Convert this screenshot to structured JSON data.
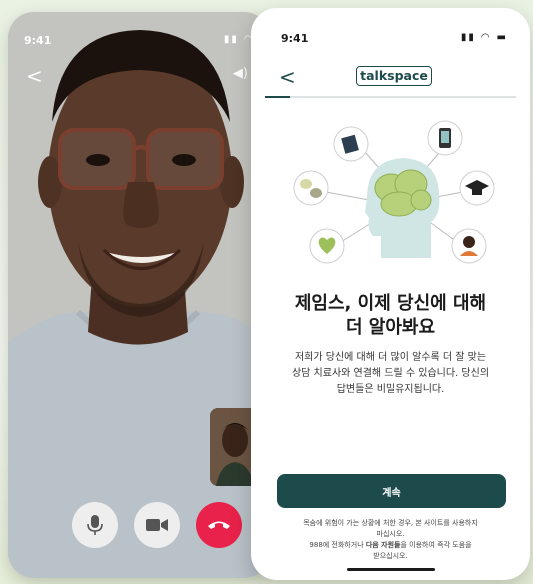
{
  "left_phone": {
    "time": "9:41",
    "status_icons": "▮▮ ◠",
    "back_glyph": "<",
    "speaker_glyph": "◀)",
    "controls": {
      "mic_icon": "microphone-icon",
      "camera_icon": "video-camera-icon",
      "end_icon": "end-call-icon"
    },
    "colors": {
      "end_call": "#e8224a",
      "control_bg": "#eeeeef"
    }
  },
  "right_phone": {
    "time": "9:41",
    "status_icons": "▮▮ ◠ ▬",
    "back_glyph": "<",
    "logo_text": "talkspace",
    "progress": 0.1,
    "headline_line1": "제임스, 이제 당신에 대해",
    "headline_line2": "더 알아봐요",
    "body_line1": "저희가 당신에 대해 더 많이 알수록 더 잘 맞는",
    "body_line2": "상담 치료사와 연결해 드릴 수 있습니다. 당신의",
    "body_line3": "답변들은 비밀유지됩니다.",
    "continue_label": "계속",
    "disclaimer_line1": "목숨에 위험이 가는 상황에 처한 경우, 본 사이트를 사용하지",
    "disclaimer_line2": "마십시오.",
    "disclaimer_line3_pre": "988에 전화하거나 ",
    "disclaimer_line3_bold": "다음 자원들",
    "disclaimer_line3_post": "을 이용하여 즉각 도움을",
    "disclaimer_line4": "받으십시오.",
    "colors": {
      "brand": "#1d4b4b",
      "brain": "#b7d07a"
    }
  }
}
